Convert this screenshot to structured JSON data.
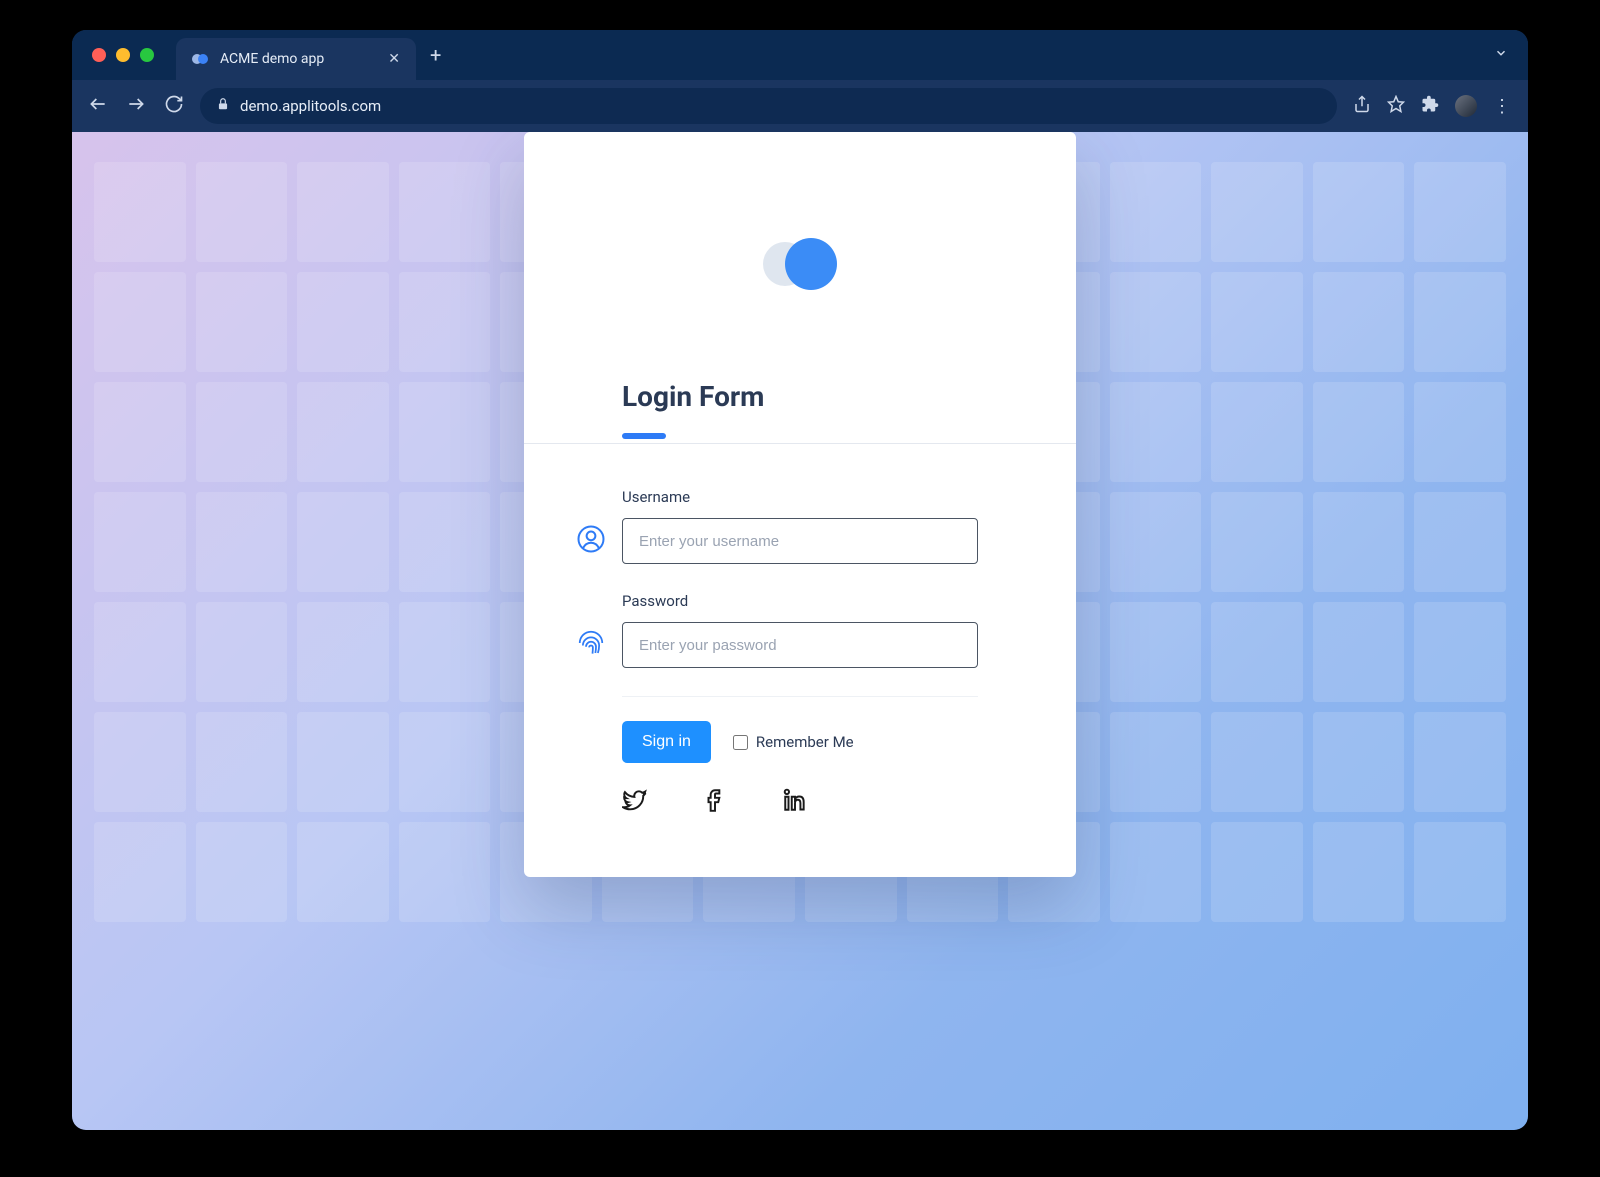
{
  "browser": {
    "tab_title": "ACME demo app",
    "url": "demo.applitools.com"
  },
  "login": {
    "title": "Login Form",
    "username_label": "Username",
    "username_placeholder": "Enter your username",
    "password_label": "Password",
    "password_placeholder": "Enter your password",
    "signin_label": "Sign in",
    "remember_label": "Remember Me"
  }
}
